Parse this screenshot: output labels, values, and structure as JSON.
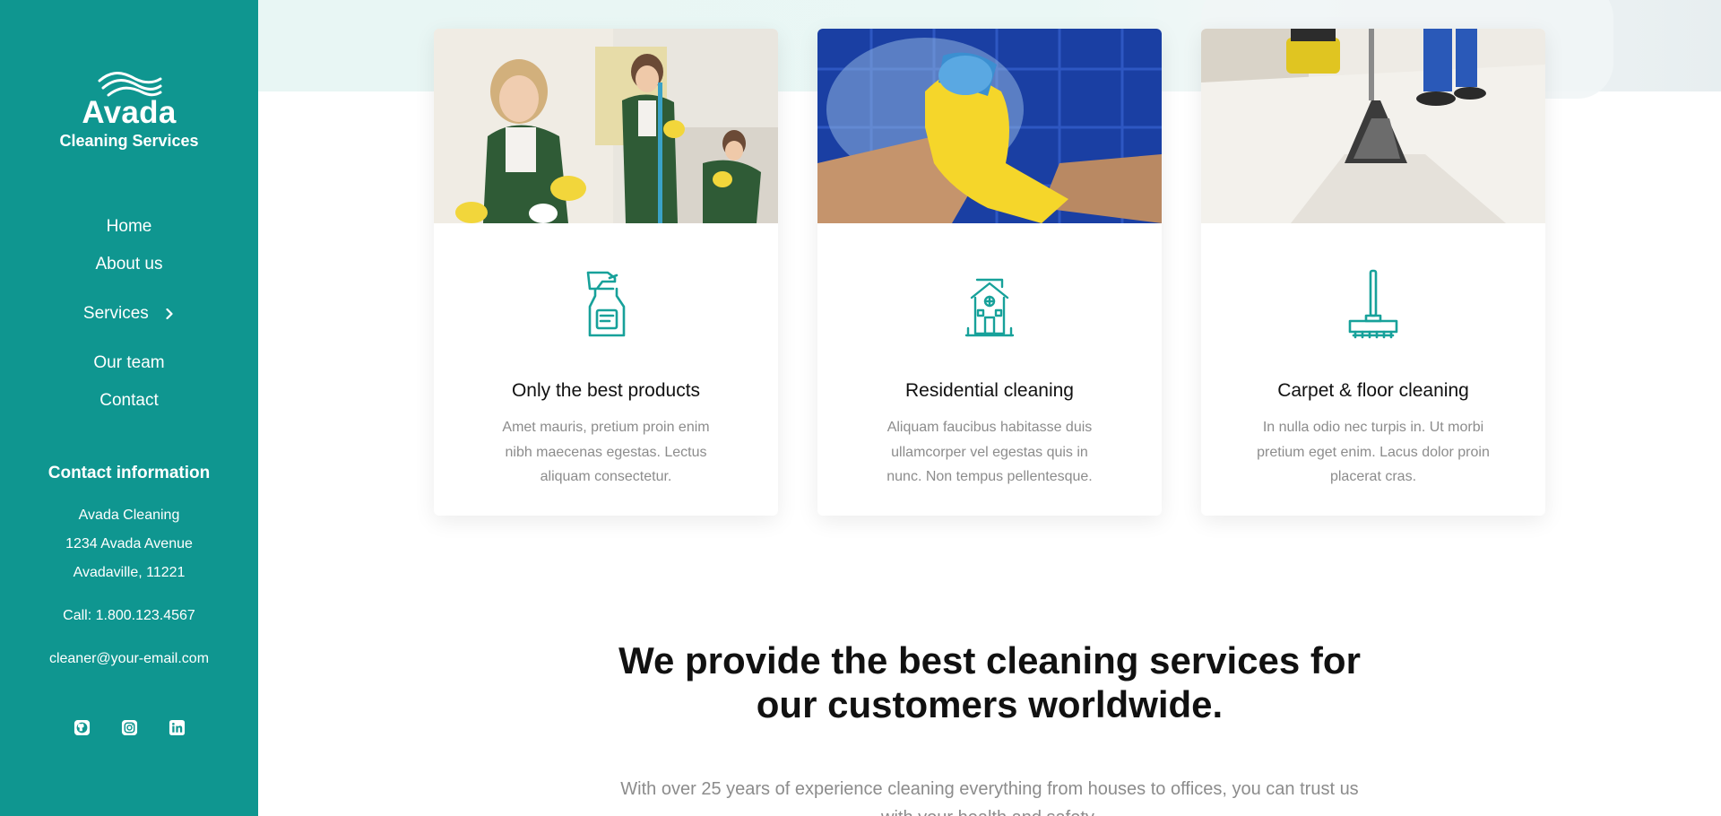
{
  "brand": {
    "name": "Avada",
    "tagline": "Cleaning Services",
    "accent_color": "#0f9690"
  },
  "nav": {
    "items": [
      {
        "label": "Home"
      },
      {
        "label": "About us"
      },
      {
        "label": "Services",
        "icon": "chevron-right-icon"
      },
      {
        "label": "Our team"
      },
      {
        "label": "Contact"
      }
    ]
  },
  "contact": {
    "title": "Contact information",
    "company": "Avada Cleaning",
    "street": "1234 Avada Avenue",
    "city": "Avadaville, 11221",
    "phone": "Call: 1.800.123.4567",
    "email": "cleaner@your-email.com"
  },
  "socials": [
    {
      "icon": "github-icon"
    },
    {
      "icon": "instagram-icon"
    },
    {
      "icon": "linkedin-icon"
    }
  ],
  "cards": [
    {
      "title": "Only the best products",
      "text": "Amet mauris, pretium proin enim nibh maecenas egestas. Lectus aliquam consectetur.",
      "icon": "spray-bottle-icon",
      "image": "cleaners-photo"
    },
    {
      "title": "Residential cleaning",
      "text": "Aliquam faucibus habitasse duis ullamcorper vel egestas quis in nunc. Non tempus pellentesque.",
      "icon": "house-icon",
      "image": "glove-wiping-glass-photo"
    },
    {
      "title": "Carpet & floor cleaning",
      "text": "In nulla odio nec turpis in. Ut morbi pretium eget enim. Lacus dolor proin placerat cras.",
      "icon": "floor-mop-icon",
      "image": "carpet-vacuum-photo"
    }
  ],
  "headline": {
    "line1": "We provide the best cleaning services for",
    "line2": "our customers worldwide."
  },
  "subtext": {
    "line1": "With over 25 years of experience cleaning everything from houses to offices, you can trust us",
    "line2": "with your health and safety."
  }
}
